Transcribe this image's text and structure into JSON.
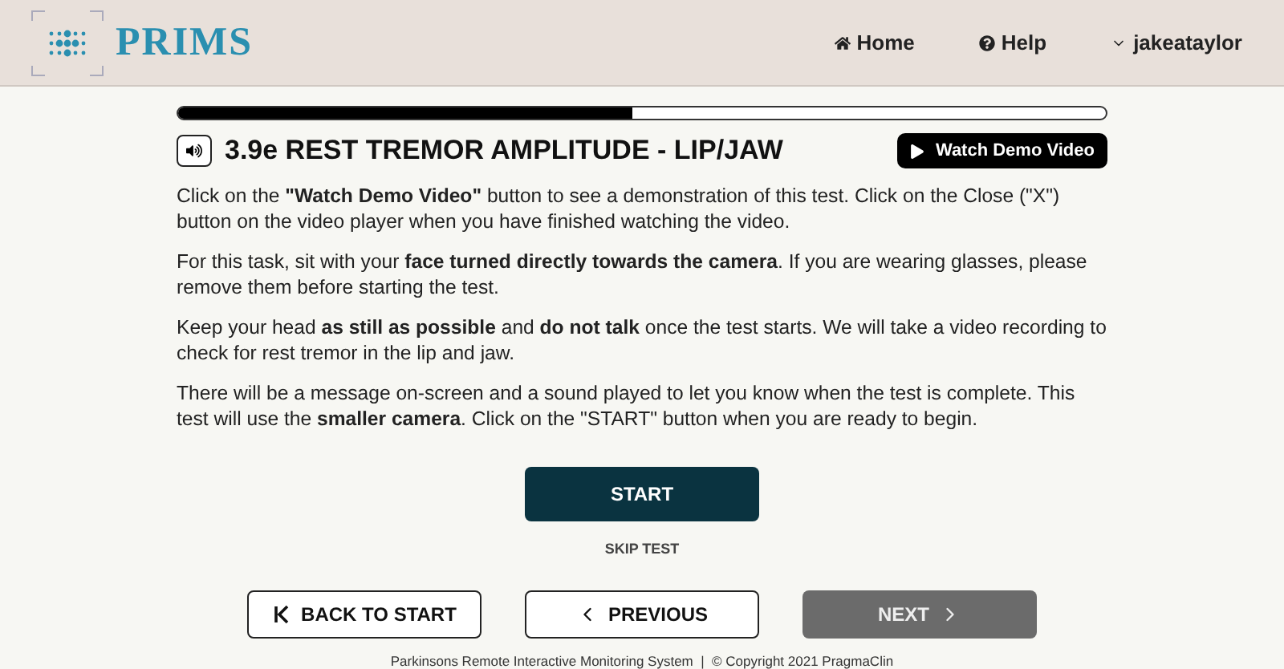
{
  "header": {
    "logo": "PRIMS",
    "nav": [
      {
        "kind": "home",
        "label": "Home"
      },
      {
        "kind": "help",
        "label": "Help"
      },
      {
        "kind": "user",
        "label": "jakeataylor"
      }
    ]
  },
  "progress": {
    "level": 0.49
  },
  "test": {
    "title": "3.9e REST TREMOR AMPLITUDE - LIP/JAW",
    "demo_button": "Watch Demo Video",
    "paragraphs": [
      "Click on the **\"Watch Demo Video\"** button to see a demonstration of this test. Click on the Close (\"X\") button on the video player when you have finished watching the video.",
      "For this task, sit with your **face turned directly towards the camera**. If you are wearing glasses, please remove them before starting the test.",
      "Keep your head **as still as possible** and **do not talk** once the test starts. We will take a video recording to check for rest tremor in the lip and jaw.",
      "There will be a message on-screen and a sound played to let you know when the test is complete. This test will use the **smaller camera**. Click on the \"START\" button when you are ready to begin."
    ],
    "start_button": "START",
    "skip_link": "SKIP TEST"
  },
  "nav_buttons": [
    {
      "kind": "first",
      "label": "BACK TO START",
      "disabled": false
    },
    {
      "kind": "prev",
      "label": "PREVIOUS",
      "disabled": false
    },
    {
      "kind": "next",
      "label": "NEXT",
      "disabled": true
    }
  ],
  "footer": "Parkinsons Remote Interactive Monitoring System  |  © Copyright 2021 PragmaClin"
}
